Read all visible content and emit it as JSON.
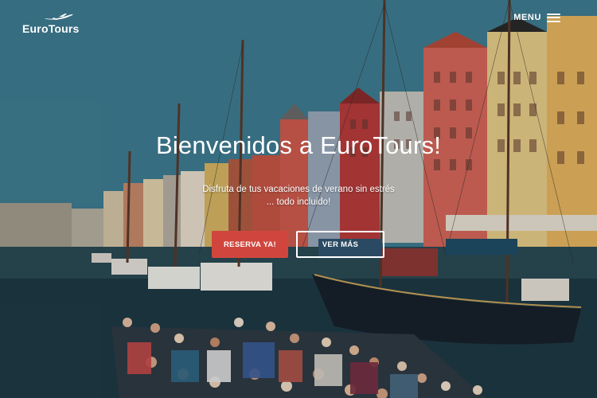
{
  "brand": {
    "name": "EuroTours"
  },
  "nav": {
    "menu_label": "MENU"
  },
  "hero": {
    "title": "Bienvenidos a EuroTours!",
    "subtitle_line1": "Disfruta de tus vacaciones de verano sin estrés",
    "subtitle_line2": "... todo incluido!",
    "primary_button": "RESERVA YA!",
    "secondary_button": "VER MÁS"
  },
  "colors": {
    "primary_button": "#d0463e",
    "text": "#ffffff"
  },
  "icons": {
    "logo": "airplane-icon",
    "menu": "hamburger-icon"
  }
}
